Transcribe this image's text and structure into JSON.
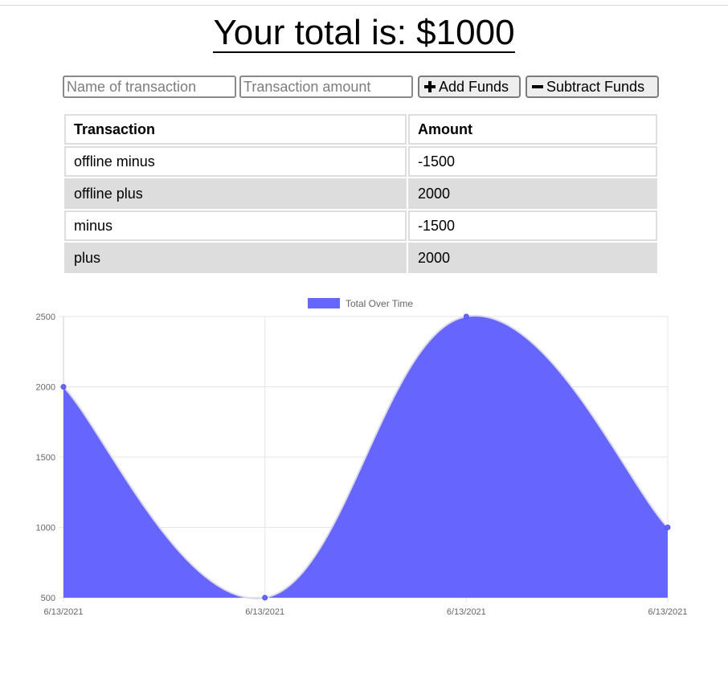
{
  "header": {
    "title": "Your total is: $1000"
  },
  "form": {
    "name_placeholder": "Name of transaction",
    "amount_placeholder": "Transaction amount",
    "add_label": "Add Funds",
    "subtract_label": "Subtract Funds",
    "add_icon": "plus-icon",
    "subtract_icon": "minus-icon"
  },
  "table": {
    "headers": [
      "Transaction",
      "Amount"
    ],
    "rows": [
      {
        "name": "offline minus",
        "amount": "-1500"
      },
      {
        "name": "offline plus",
        "amount": "2000"
      },
      {
        "name": "minus",
        "amount": "-1500"
      },
      {
        "name": "plus",
        "amount": "2000"
      }
    ],
    "stripe_color": "#dddddd"
  },
  "chart_data": {
    "type": "area",
    "x": [
      "6/13/2021",
      "6/13/2021",
      "6/13/2021",
      "6/13/2021"
    ],
    "series": [
      {
        "name": "Total Over Time",
        "values": [
          2000,
          500,
          2500,
          1000
        ],
        "color": "#6666ff"
      }
    ],
    "ylim": [
      500,
      2500
    ],
    "yticks": [
      500,
      1000,
      1500,
      2000,
      2500
    ],
    "grid": true,
    "legend": "top-center",
    "title": "",
    "xlabel": "",
    "ylabel": ""
  }
}
